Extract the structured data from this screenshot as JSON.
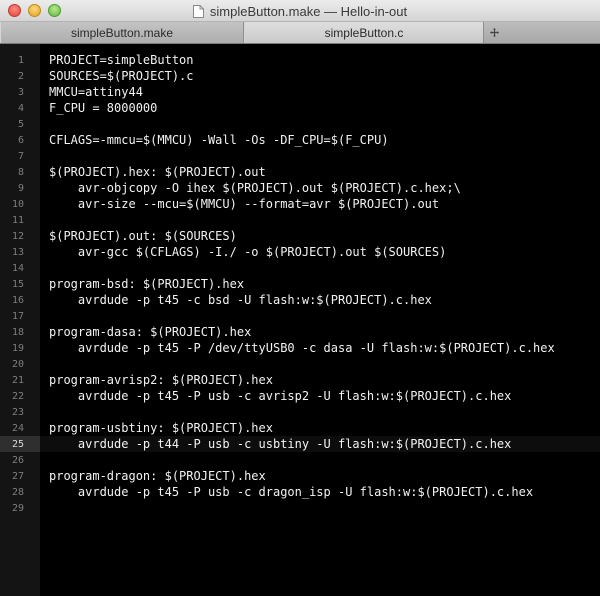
{
  "window": {
    "title": "simpleButton.make — Hello-in-out"
  },
  "tabs": [
    {
      "label": "simpleButton.make",
      "active": false
    },
    {
      "label": "simpleButton.c",
      "active": true
    }
  ],
  "new_tab_icon": "plus-icon",
  "editor": {
    "current_line": 25,
    "lines": [
      "PROJECT=simpleButton",
      "SOURCES=$(PROJECT).c",
      "MMCU=attiny44",
      "F_CPU = 8000000",
      "",
      "CFLAGS=-mmcu=$(MMCU) -Wall -Os -DF_CPU=$(F_CPU)",
      "",
      "$(PROJECT).hex: $(PROJECT).out",
      "    avr-objcopy -O ihex $(PROJECT).out $(PROJECT).c.hex;\\",
      "    avr-size --mcu=$(MMCU) --format=avr $(PROJECT).out",
      "",
      "$(PROJECT).out: $(SOURCES)",
      "    avr-gcc $(CFLAGS) -I./ -o $(PROJECT).out $(SOURCES)",
      "",
      "program-bsd: $(PROJECT).hex",
      "    avrdude -p t45 -c bsd -U flash:w:$(PROJECT).c.hex",
      "",
      "program-dasa: $(PROJECT).hex",
      "    avrdude -p t45 -P /dev/ttyUSB0 -c dasa -U flash:w:$(PROJECT).c.hex",
      "",
      "program-avrisp2: $(PROJECT).hex",
      "    avrdude -p t45 -P usb -c avrisp2 -U flash:w:$(PROJECT).c.hex",
      "",
      "program-usbtiny: $(PROJECT).hex",
      "    avrdude -p t44 -P usb -c usbtiny -U flash:w:$(PROJECT).c.hex",
      "",
      "program-dragon: $(PROJECT).hex",
      "    avrdude -p t45 -P usb -c dragon_isp -U flash:w:$(PROJECT).c.hex",
      ""
    ],
    "line_numbers": [
      "1",
      "2",
      "3",
      "4",
      "5",
      "6",
      "7",
      "8",
      "9",
      "10",
      "11",
      "12",
      "13",
      "14",
      "15",
      "16",
      "17",
      "18",
      "19",
      "20",
      "21",
      "22",
      "23",
      "24",
      "25",
      "26",
      "27",
      "28",
      "29"
    ]
  },
  "colors": {
    "background": "#000000",
    "gutter": "#141414",
    "text": "#f2f2f2",
    "line_number": "#7d7d7d"
  }
}
